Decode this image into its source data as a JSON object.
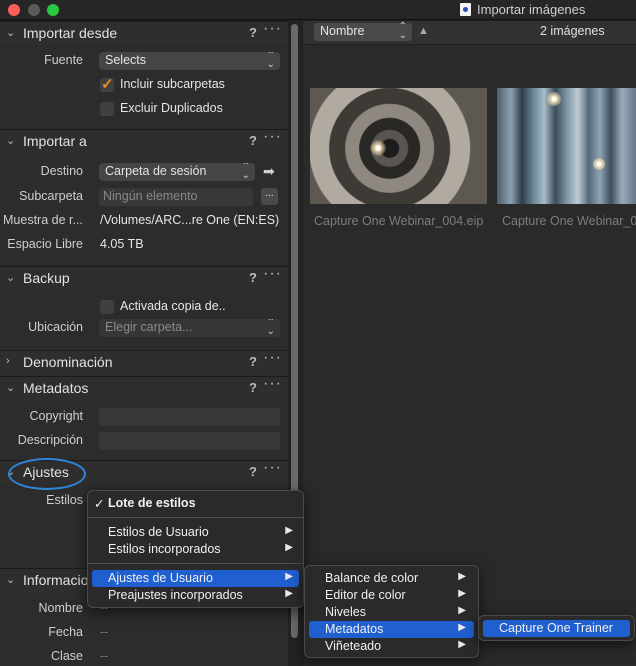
{
  "window": {
    "title": "Importar imágenes"
  },
  "left_panel": {
    "importar_desde": {
      "title": "Importar desde",
      "help": "?",
      "more": "···",
      "fuente_label": "Fuente",
      "fuente_value": "Selects",
      "incluir_label": "Incluir subcarpetas",
      "incluir_checked": true,
      "excluir_label": "Excluir Duplicados",
      "excluir_checked": false
    },
    "importar_a": {
      "title": "Importar a",
      "help": "?",
      "more": "···",
      "destino_label": "Destino",
      "destino_value": "Carpeta de sesión",
      "subcarpeta_label": "Subcarpeta",
      "subcarpeta_placeholder": "Ningún elemento",
      "subcarpeta_button": "...",
      "muestra_label": "Muestra de r...",
      "muestra_value": "/Volumes/ARC...re One (EN:ES)",
      "espacio_label": "Espacio Libre",
      "espacio_value": "4.05 TB"
    },
    "backup": {
      "title": "Backup",
      "help": "?",
      "more": "···",
      "activada_label": "Activada copia de..",
      "ubicacion_label": "Ubicación",
      "ubicacion_placeholder": "Elegir carpeta..."
    },
    "denominacion": {
      "title": "Denominación",
      "help": "?",
      "more": "···"
    },
    "metadatos": {
      "title": "Metadatos",
      "help": "?",
      "more": "···",
      "copyright_label": "Copyright",
      "descripcion_label": "Descripción"
    },
    "ajustes": {
      "title": "Ajustes",
      "help": "?",
      "more": "···",
      "estilos_label": "Estilos"
    },
    "informacion": {
      "title": "Informacion",
      "nombre_label": "Nombre",
      "nombre_value": "--",
      "fecha_label": "Fecha",
      "fecha_value": "--",
      "clase_label": "Clase",
      "clase_value": "--"
    }
  },
  "browser": {
    "sort_value": "Nombre",
    "count": "2 imágenes",
    "thumbnails": [
      {
        "caption": "Capture One Webinar_004.eip"
      },
      {
        "caption": "Capture One Webinar_0"
      }
    ]
  },
  "menus": {
    "main": {
      "checked_item": "Lote de estilos",
      "items": [
        "Estilos de Usuario",
        "Estilos incorporados",
        "Ajustes de Usuario",
        "Preajustes incorporados"
      ]
    },
    "ajustes_sub": [
      "Balance de color",
      "Editor de color",
      "Niveles",
      "Metadatos",
      "Viñeteado"
    ],
    "metadatos_sub": [
      "Capture One Trainer"
    ]
  },
  "colors": {
    "accent": "#f08a24",
    "highlight": "#1f5fd0",
    "annotation_circle": "#2f86d8"
  }
}
